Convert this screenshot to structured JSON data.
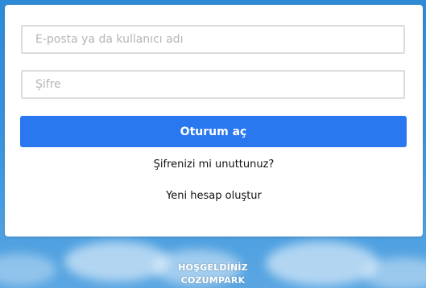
{
  "login_form": {
    "email_placeholder": "E-posta ya da kullanıcı adı",
    "email_value": "",
    "password_placeholder": "Şifre",
    "password_value": "",
    "login_button_label": "Oturum aç",
    "forgot_password_label": "Şifrenizi mi unuttunuz?",
    "create_account_label": "Yeni hesap oluştur"
  },
  "footer": {
    "line1": "HOŞGELDİNİZ",
    "line2": "COZUMPARK"
  },
  "colors": {
    "accent": "#2a78ef",
    "background": "#3a92dc"
  }
}
